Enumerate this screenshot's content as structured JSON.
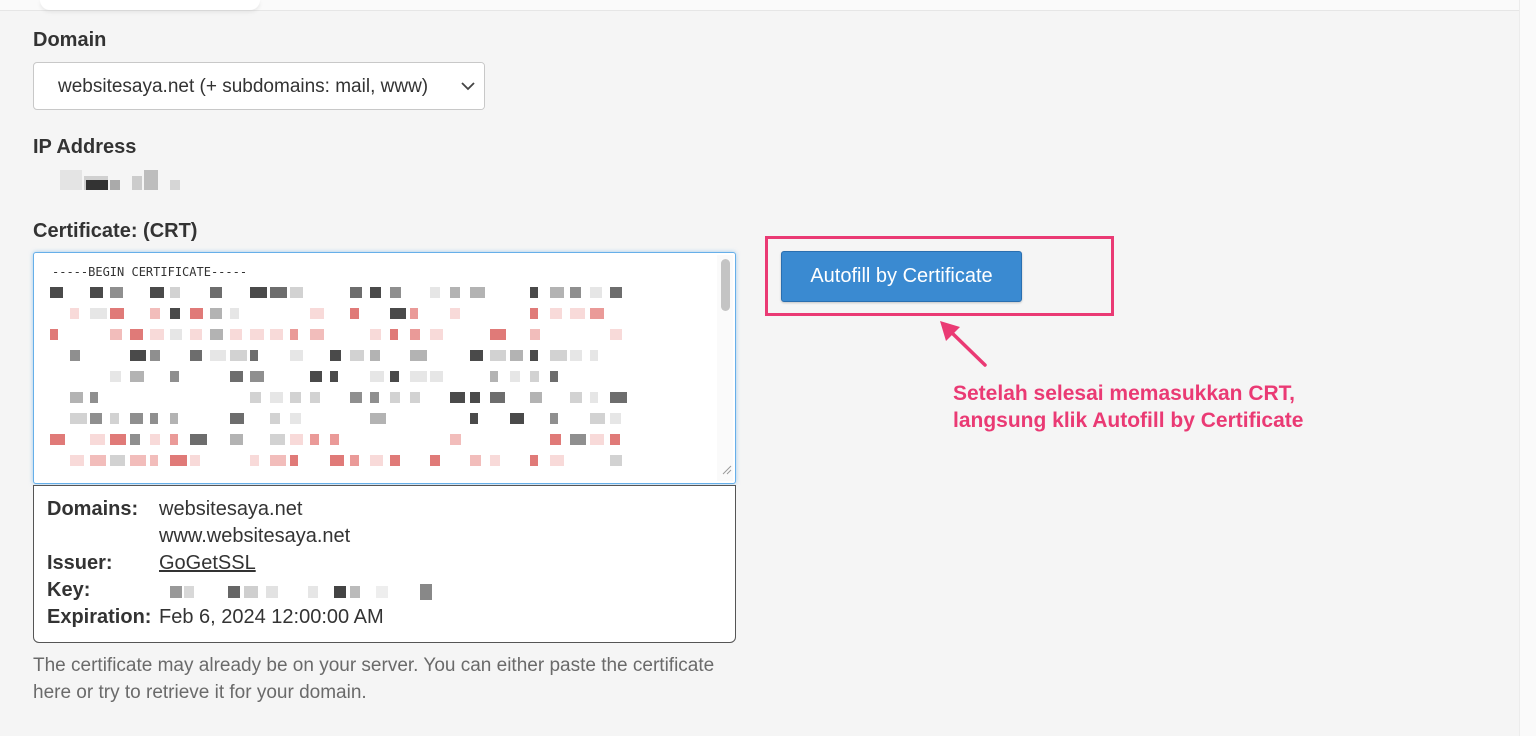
{
  "form": {
    "domain_label": "Domain",
    "domain_value": "websitesaya.net    (+ subdomains: mail, www)",
    "ip_label": "IP Address",
    "cert_label": "Certificate: (CRT)",
    "cert_first_line": "-----BEGIN CERTIFICATE-----"
  },
  "cert_info": {
    "domains_label": "Domains:",
    "domains": [
      "websitesaya.net",
      "www.websitesaya.net"
    ],
    "issuer_label": "Issuer:",
    "issuer": "GoGetSSL",
    "key_label": "Key:",
    "expiration_label": "Expiration:",
    "expiration": "Feb 6, 2024 12:00:00 AM"
  },
  "help_text": "The certificate may already be on your server. You can either paste the certificate here or try to retrieve it for your domain.",
  "autofill_button": "Autofill by Certificate",
  "annotation_text": "Setelah selesai memasukkan CRT, langsung klik Autofill by Certificate",
  "colors": {
    "accent": "#ea3a74",
    "button": "#3a8ad1",
    "focus_border": "#66afe9"
  }
}
